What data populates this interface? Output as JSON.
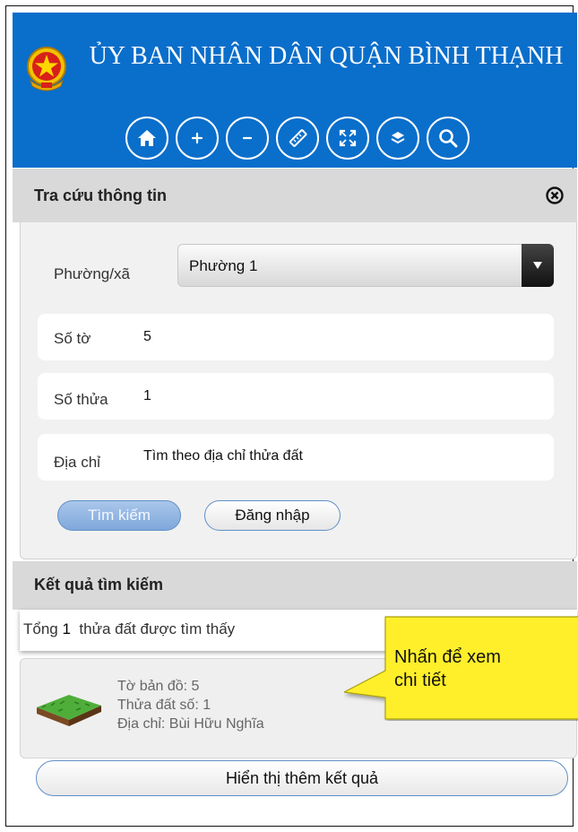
{
  "header": {
    "title": "ỦY BAN NHÂN DÂN QUẬN BÌNH THẠNH",
    "toolbar": [
      {
        "name": "home-icon",
        "label": "Home"
      },
      {
        "name": "zoom-in-icon",
        "label": "+"
      },
      {
        "name": "zoom-out-icon",
        "label": "–"
      },
      {
        "name": "ruler-icon",
        "label": "Measure"
      },
      {
        "name": "fullscreen-icon",
        "label": "Full extent"
      },
      {
        "name": "layers-icon",
        "label": "Layers"
      },
      {
        "name": "search-icon",
        "label": "Search"
      }
    ]
  },
  "search_panel": {
    "title": "Tra cứu thông tin",
    "ward_label": "Phường/xã",
    "ward_value": "Phường 1",
    "sheet_label": "Số tờ",
    "sheet_value": "5",
    "parcel_label": "Số thửa",
    "parcel_value": "1",
    "address_label": "Địa chỉ",
    "address_placeholder": "Tìm theo địa chỉ thửa đất",
    "search_button": "Tìm kiếm",
    "login_button": "Đăng nhập"
  },
  "results": {
    "title": "Kết quả tìm kiếm",
    "count_prefix": "Tổng ",
    "count": "1",
    "count_suffix": "  thửa đất được tìm thấy",
    "items": [
      {
        "sheet": "Tờ bản đồ: 5",
        "parcel": "Thửa đất số: 1",
        "address": "Địa chỉ: Bùi Hữu Nghĩa"
      }
    ],
    "more_button": "Hiển thị thêm kết quả"
  },
  "callout": {
    "line1": "Nhấn để xem",
    "line2": "chi tiết"
  },
  "colors": {
    "header_blue": "#0a6ecb",
    "panel_gray": "#d9d9d9",
    "callout_yellow": "#ffef2a"
  }
}
